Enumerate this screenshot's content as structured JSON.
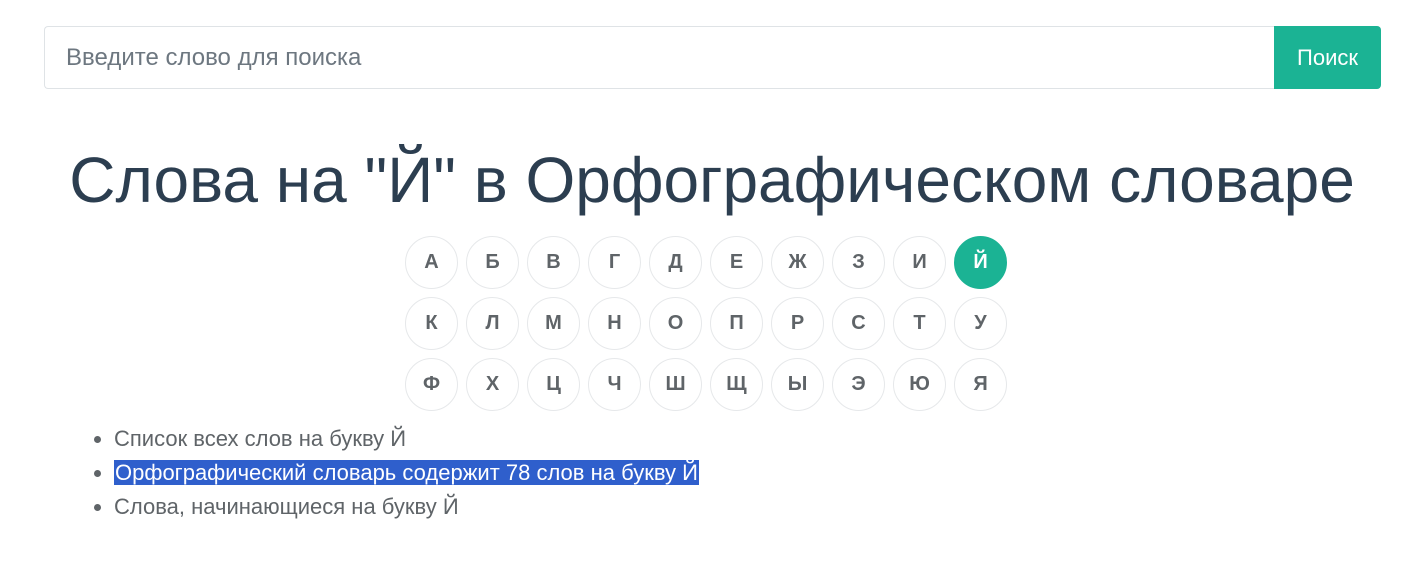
{
  "search": {
    "placeholder": "Введите слово для поиска",
    "value": "",
    "button_label": "Поиск"
  },
  "title": "Слова на \"Й\" в Орфографическом словаре",
  "alphabet": {
    "active": "Й",
    "letters": [
      "А",
      "Б",
      "В",
      "Г",
      "Д",
      "Е",
      "Ж",
      "З",
      "И",
      "Й",
      "К",
      "Л",
      "М",
      "Н",
      "О",
      "П",
      "Р",
      "С",
      "Т",
      "У",
      "Ф",
      "Х",
      "Ц",
      "Ч",
      "Ш",
      "Щ",
      "Ы",
      "Э",
      "Ю",
      "Я"
    ]
  },
  "info": {
    "items": [
      "Список всех слов на букву Й",
      "Орфографический словарь содержит 78 слов на букву Й",
      "Слова, начинающиеся на букву Й"
    ],
    "selected_index": 1
  },
  "colors": {
    "accent": "#1bb394",
    "title": "#2c3e50",
    "text": "#5f6468",
    "selection": "#2f5fcc"
  }
}
